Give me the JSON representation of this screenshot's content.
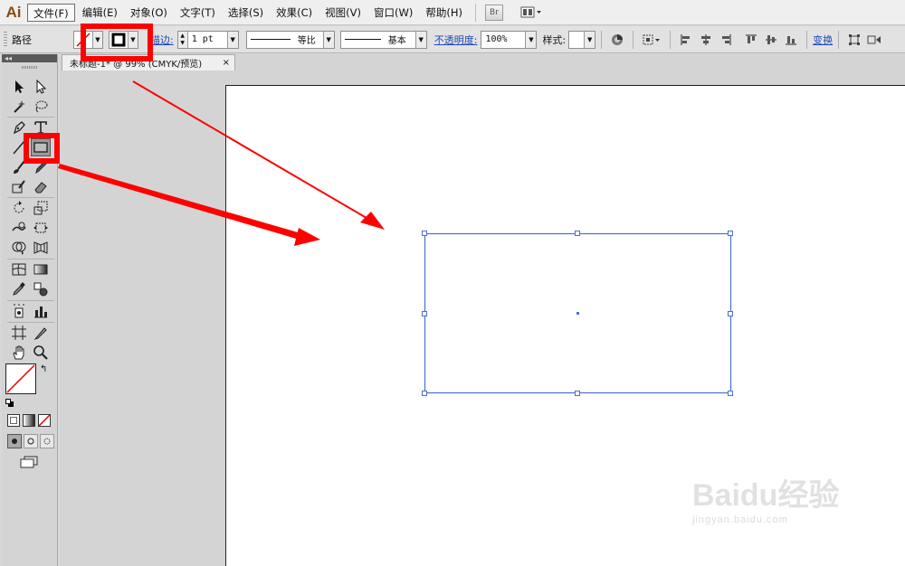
{
  "app": {
    "logo": "Ai"
  },
  "menu": {
    "items": [
      "文件(F)",
      "编辑(E)",
      "对象(O)",
      "文字(T)",
      "选择(S)",
      "效果(C)",
      "视图(V)",
      "窗口(W)",
      "帮助(H)"
    ],
    "bridge_label": "Br"
  },
  "control": {
    "object_type": "路径",
    "stroke_label": "描边:",
    "stroke_weight": "1 pt",
    "profile_label": "等比",
    "brush_label": "基本",
    "opacity_label": "不透明度:",
    "opacity_value": "100%",
    "style_label": "样式:",
    "transform_label": "变换"
  },
  "toolbox": {
    "collapse_glyph": "◂◂"
  },
  "document": {
    "tab_title": "未标题-1* @ 99% (CMYK/预览)",
    "close_glyph": "×"
  },
  "watermark": {
    "text": "Baidu经验",
    "sub": "jingyan.baidu.com"
  },
  "colors": {
    "highlight": "#ff0000",
    "selection": "#4a6fd4",
    "logo": "#8a4a0f"
  }
}
